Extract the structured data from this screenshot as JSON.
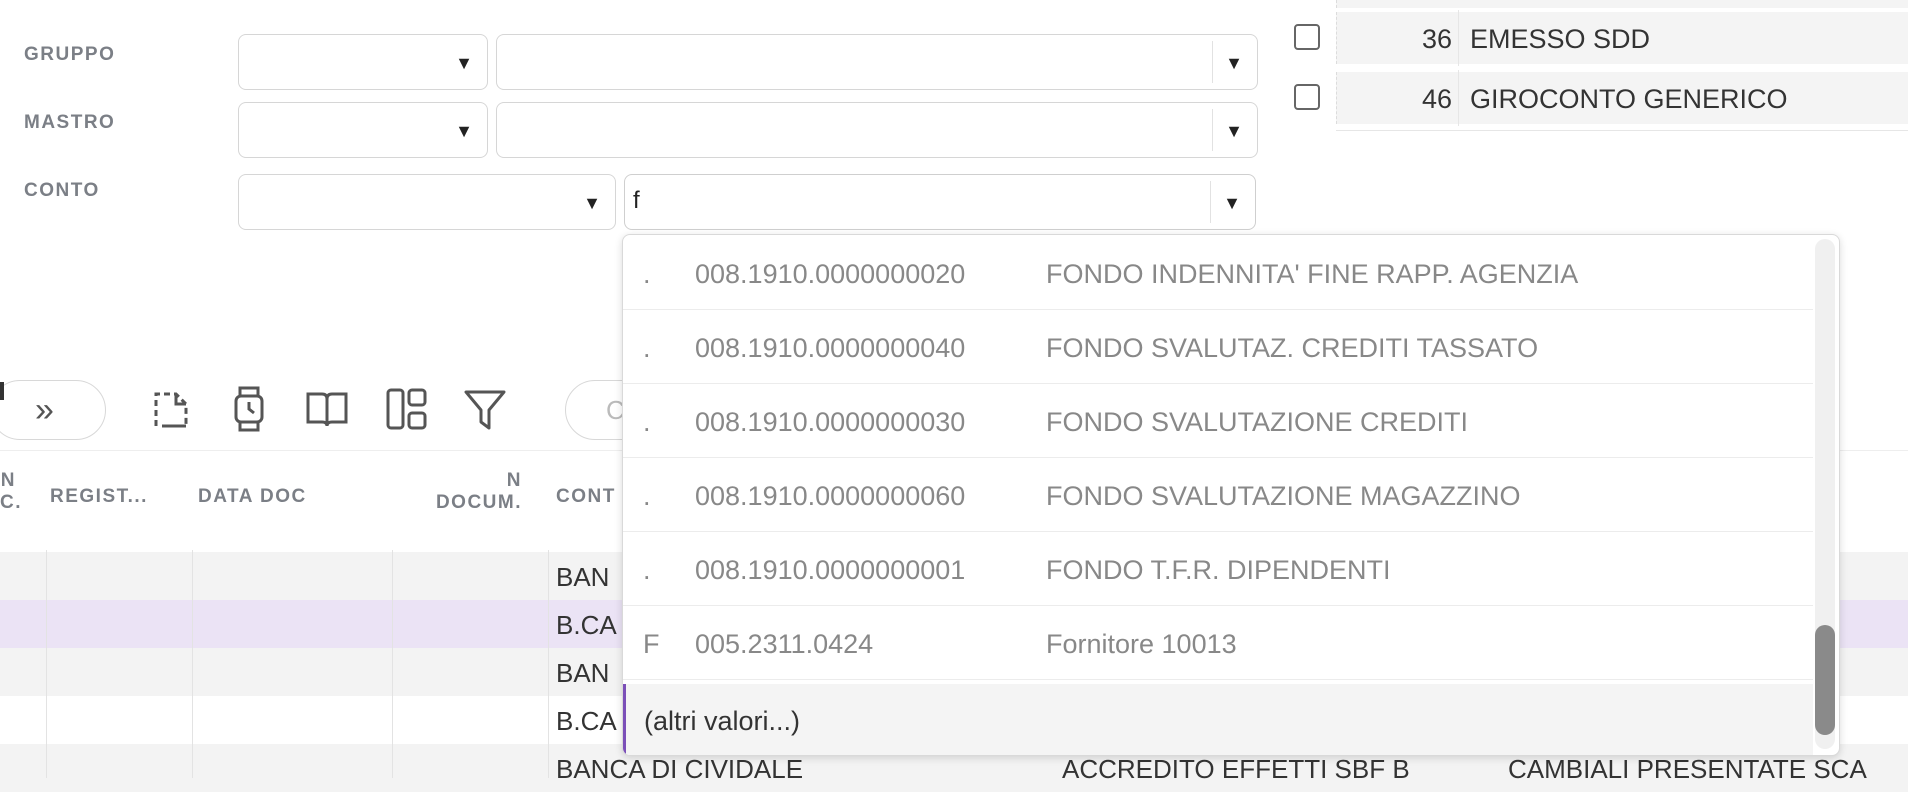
{
  "filters": {
    "gruppo_label": "GRUPPO",
    "mastro_label": "MASTRO",
    "conto_label": "CONTO",
    "conto_search_value": "f"
  },
  "causali_list": [
    {
      "code": "36",
      "description": "EMESSO SDD"
    },
    {
      "code": "46",
      "description": "GIROCONTO GENERICO"
    }
  ],
  "toolbar": {
    "icons": [
      "chevron-double-right-icon",
      "new-document-icon",
      "watch-icon",
      "book-icon",
      "layout-icon",
      "filter-icon"
    ],
    "search_placeholder": "C"
  },
  "grid": {
    "headers": {
      "n_reg_top": "N",
      "n_reg_bottom": "C.",
      "registro": "REGIST...",
      "data_doc": "DATA DOC",
      "n_docum_top": "N",
      "n_docum_bottom": "DOCUM.",
      "conto": "CONT"
    },
    "rows": [
      {
        "conto": "BAN",
        "col2": "",
        "col3": ""
      },
      {
        "conto": "B.CA",
        "col2": "",
        "col3": ""
      },
      {
        "conto": "BAN",
        "col2": "",
        "col3": ""
      },
      {
        "conto": "B.CA",
        "col2": "",
        "col3": ""
      },
      {
        "conto": "BANCA DI CIVIDALE",
        "col2": "ACCREDITO EFFETTI SBF B",
        "col3": "CAMBIALI PRESENTATE SCA"
      }
    ]
  },
  "dropdown": {
    "items": [
      {
        "type": ".",
        "code": "008.1910.0000000020",
        "description": "FONDO INDENNITA' FINE RAPP. AGENZIA"
      },
      {
        "type": ".",
        "code": "008.1910.0000000040",
        "description": "FONDO SVALUTAZ. CREDITI TASSATO"
      },
      {
        "type": ".",
        "code": "008.1910.0000000030",
        "description": "FONDO SVALUTAZIONE CREDITI"
      },
      {
        "type": ".",
        "code": "008.1910.0000000060",
        "description": "FONDO SVALUTAZIONE MAGAZZINO"
      },
      {
        "type": ".",
        "code": "008.1910.0000000001",
        "description": "FONDO T.F.R. DIPENDENTI"
      },
      {
        "type": "F",
        "code": "005.2311.0424",
        "description": "Fornitore 10013"
      }
    ],
    "more_label": "(altri valori...)"
  },
  "colors": {
    "selected_row": "#ebe3f5",
    "accent": "#7b4fb8",
    "row_alt": "#f3f3f3"
  }
}
